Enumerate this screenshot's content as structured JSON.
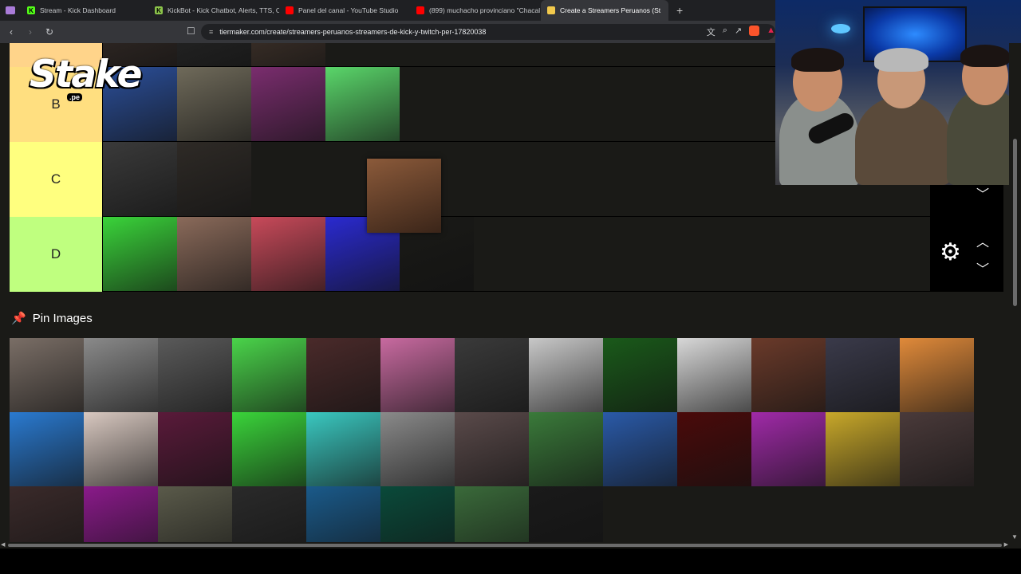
{
  "browser": {
    "tabs": [
      {
        "title": "Stream - Kick Dashboard",
        "favicon": "K",
        "favicon_color": "#53fc18",
        "active": false
      },
      {
        "title": "KickBot - Kick Chatbot, Alerts, TTS, O",
        "favicon": "K",
        "favicon_color": "#8bc34a",
        "active": false
      },
      {
        "title": "Panel del canal - YouTube Studio",
        "favicon": "",
        "favicon_color": "#ff0000",
        "active": false
      },
      {
        "title": "(899) muchacho provinciano \"Chacal",
        "favicon": "",
        "favicon_color": "#ff0000",
        "active": false
      },
      {
        "title": "Create a Streamers Peruanos (St",
        "favicon": "",
        "favicon_color": "#f2c94c",
        "active": true
      }
    ],
    "new_tab": "+",
    "close_tab": "×",
    "url": "tiermaker.com/create/streamers-peruanos-streamers-de-kick-y-twitch-per-17820038"
  },
  "tiers": [
    {
      "label": "",
      "color": "#ffd48a",
      "items": [
        "#3a2f2a",
        "#2a2a2a",
        "#4a3a30"
      ]
    },
    {
      "label": "B",
      "color": "#ffdf80",
      "items": [
        "#2b4f9a",
        "#6f6a5a",
        "#7a2d6e",
        "#5ad66a"
      ]
    },
    {
      "label": "C",
      "color": "#ffff7f",
      "items": [
        "#3a3a3a",
        "#2e2a26"
      ]
    },
    {
      "label": "D",
      "color": "#bfff7f",
      "items": [
        "#3ad43a",
        "#8a6a5a",
        "#c84a5a",
        "#2a2ad0",
        "#1a1a17"
      ]
    }
  ],
  "floating_item_color": "#8b5a3a",
  "tier_controls": {
    "gear": "⚙",
    "up": "︿",
    "down": "﹀"
  },
  "pin_section": {
    "title": "Pin Images",
    "icon": "pin-icon"
  },
  "pool_images": [
    "#7a6e66",
    "#8a8a8a",
    "#5a5a5a",
    "#4ad44a",
    "#4a2a2a",
    "#c86aa0",
    "#3a3a3a",
    "#c8c8c8",
    "#1a5a1a",
    "#d8d8d8",
    "#6a3a2a",
    "#3a3a4a",
    "#e08a3a",
    "#2a7ad0",
    "#d8c8c0",
    "#5a1a3a",
    "#3ad43a",
    "#3ac8c0",
    "#8a8a8a",
    "#5a4a4a",
    "#3a7a3a",
    "#2a5aa8",
    "#4a0a0a",
    "#a02aa8",
    "#c8a82a",
    "#4a3a3a",
    "#3a2a2a",
    "#8a1a8a",
    "#5a5a4a",
    "#2a2a2a",
    "#1a5a8a",
    "#0a4a3a",
    "#3a6a3a",
    "#1a1a1a"
  ],
  "overlay": {
    "brand": "Stake",
    "brand_sub": ".pe"
  },
  "colors": {
    "page_bg": "#1a1a17",
    "chrome_bg": "#35363a",
    "tab_bg": "#1f2023"
  }
}
